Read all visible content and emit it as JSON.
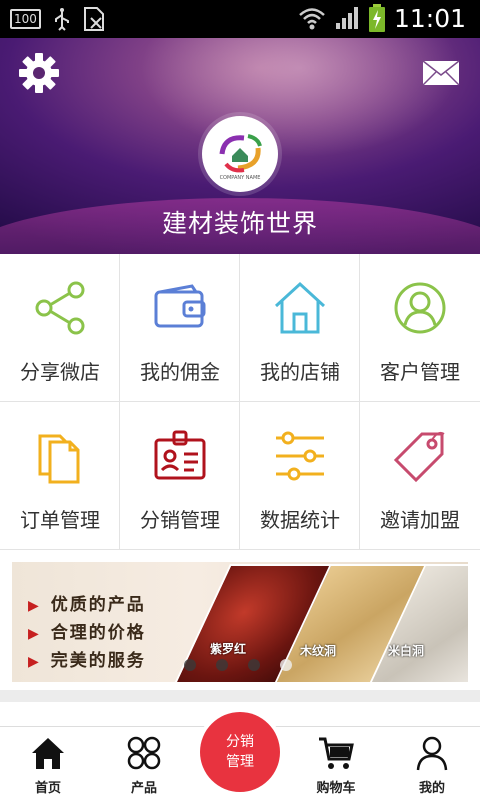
{
  "status_bar": {
    "battery_badge": "100",
    "time": "11:01"
  },
  "header": {
    "store_name": "建材装饰世界",
    "logo_caption": "COMPANY NAME"
  },
  "menu": [
    {
      "label": "分享微店",
      "icon": "share-icon",
      "color": "#8bc34a"
    },
    {
      "label": "我的佣金",
      "icon": "wallet-icon",
      "color": "#5b7fd6"
    },
    {
      "label": "我的店铺",
      "icon": "home-icon",
      "color": "#4ab8d8"
    },
    {
      "label": "客户管理",
      "icon": "user-circle-icon",
      "color": "#8bc34a"
    },
    {
      "label": "订单管理",
      "icon": "documents-icon",
      "color": "#f2b01e"
    },
    {
      "label": "分销管理",
      "icon": "id-badge-icon",
      "color": "#b0121c"
    },
    {
      "label": "数据统计",
      "icon": "sliders-icon",
      "color": "#f2b01e"
    },
    {
      "label": "邀请加盟",
      "icon": "tag-icon",
      "color": "#c74b6e"
    }
  ],
  "banner": {
    "lines": [
      "优质的产品",
      "合理的价格",
      "完美的服务"
    ],
    "tiles": [
      "紫罗红",
      "木纹洞",
      "米白洞"
    ],
    "dots_total": 4,
    "dots_active_index": 3
  },
  "bottom_nav": {
    "items": [
      {
        "label": "首页",
        "icon": "home-icon"
      },
      {
        "label": "产品",
        "icon": "grid-icon"
      },
      {
        "label": "购物车",
        "icon": "cart-icon"
      },
      {
        "label": "我的",
        "icon": "person-icon"
      }
    ],
    "center": {
      "line1": "分销",
      "line2": "管理",
      "color": "#e8333f"
    }
  }
}
